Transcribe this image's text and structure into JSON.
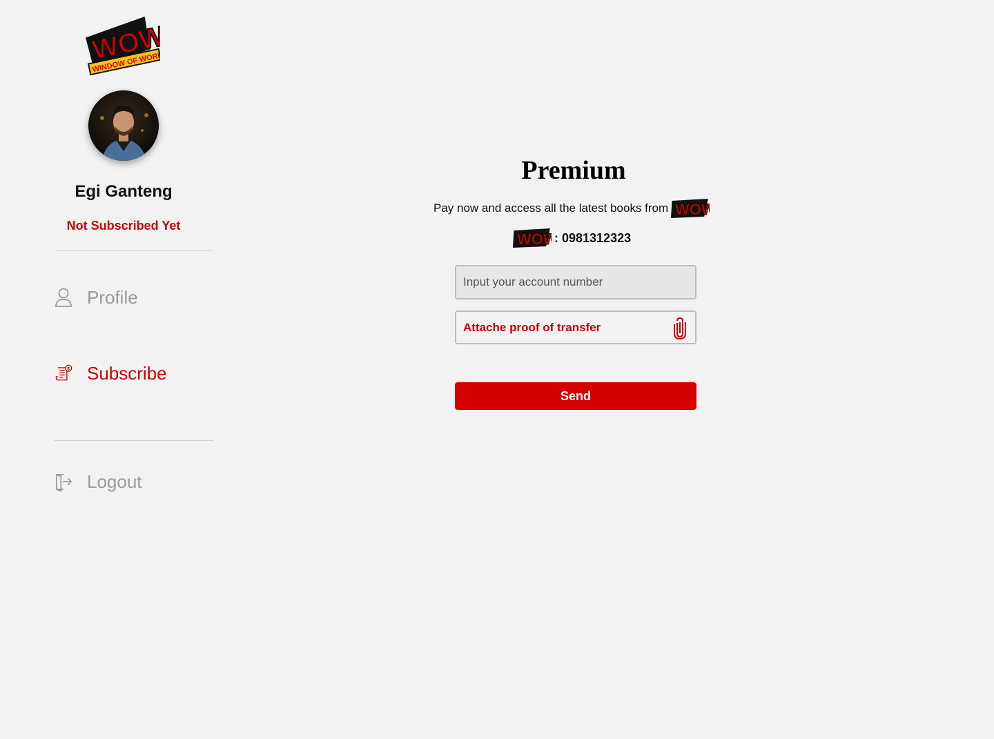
{
  "brand": {
    "logo_word": "WOW",
    "logo_tagline": "WINDOW OF WORLD",
    "primary_color": "#d40000",
    "accent_color": "#f5c518"
  },
  "sidebar": {
    "user_name": "Egi Ganteng",
    "subscription_status": "Not Subscribed Yet",
    "items": [
      {
        "label": "Profile",
        "icon": "user-icon",
        "active": false
      },
      {
        "label": "Subscribe",
        "icon": "bill-dollar-icon",
        "active": true
      },
      {
        "label": "Logout",
        "icon": "logout-icon",
        "active": false
      }
    ]
  },
  "main": {
    "title": "Premium",
    "info_text": "Pay now and access all the latest books from",
    "account_number": ": 0981312323",
    "account_input": {
      "placeholder": "Input your account number",
      "value": ""
    },
    "attach_label": "Attache proof of transfer",
    "send_label": "Send"
  }
}
